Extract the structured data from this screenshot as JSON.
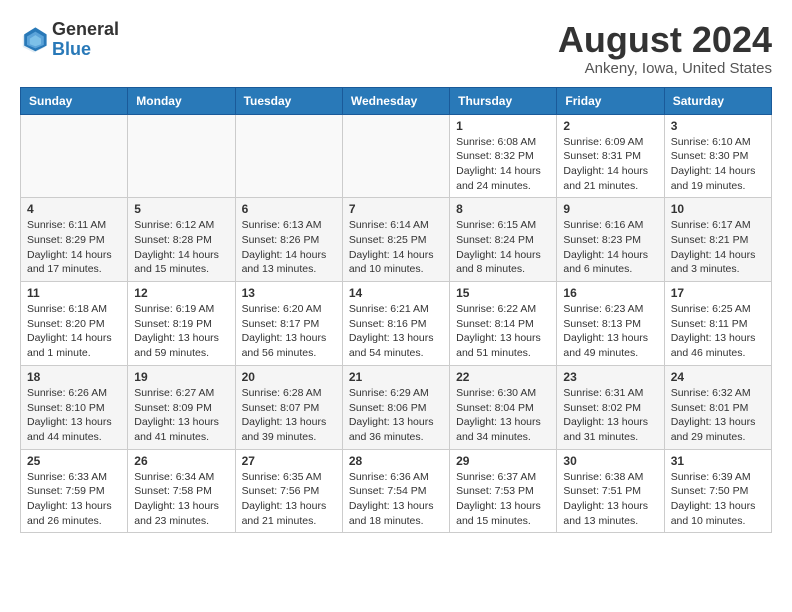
{
  "logo": {
    "text_general": "General",
    "text_blue": "Blue"
  },
  "title": {
    "month_year": "August 2024",
    "location": "Ankeny, Iowa, United States"
  },
  "days_of_week": [
    "Sunday",
    "Monday",
    "Tuesday",
    "Wednesday",
    "Thursday",
    "Friday",
    "Saturday"
  ],
  "weeks": [
    {
      "alt": false,
      "days": [
        {
          "num": "",
          "info": ""
        },
        {
          "num": "",
          "info": ""
        },
        {
          "num": "",
          "info": ""
        },
        {
          "num": "",
          "info": ""
        },
        {
          "num": "1",
          "info": "Sunrise: 6:08 AM\nSunset: 8:32 PM\nDaylight: 14 hours\nand 24 minutes."
        },
        {
          "num": "2",
          "info": "Sunrise: 6:09 AM\nSunset: 8:31 PM\nDaylight: 14 hours\nand 21 minutes."
        },
        {
          "num": "3",
          "info": "Sunrise: 6:10 AM\nSunset: 8:30 PM\nDaylight: 14 hours\nand 19 minutes."
        }
      ]
    },
    {
      "alt": true,
      "days": [
        {
          "num": "4",
          "info": "Sunrise: 6:11 AM\nSunset: 8:29 PM\nDaylight: 14 hours\nand 17 minutes."
        },
        {
          "num": "5",
          "info": "Sunrise: 6:12 AM\nSunset: 8:28 PM\nDaylight: 14 hours\nand 15 minutes."
        },
        {
          "num": "6",
          "info": "Sunrise: 6:13 AM\nSunset: 8:26 PM\nDaylight: 14 hours\nand 13 minutes."
        },
        {
          "num": "7",
          "info": "Sunrise: 6:14 AM\nSunset: 8:25 PM\nDaylight: 14 hours\nand 10 minutes."
        },
        {
          "num": "8",
          "info": "Sunrise: 6:15 AM\nSunset: 8:24 PM\nDaylight: 14 hours\nand 8 minutes."
        },
        {
          "num": "9",
          "info": "Sunrise: 6:16 AM\nSunset: 8:23 PM\nDaylight: 14 hours\nand 6 minutes."
        },
        {
          "num": "10",
          "info": "Sunrise: 6:17 AM\nSunset: 8:21 PM\nDaylight: 14 hours\nand 3 minutes."
        }
      ]
    },
    {
      "alt": false,
      "days": [
        {
          "num": "11",
          "info": "Sunrise: 6:18 AM\nSunset: 8:20 PM\nDaylight: 14 hours\nand 1 minute."
        },
        {
          "num": "12",
          "info": "Sunrise: 6:19 AM\nSunset: 8:19 PM\nDaylight: 13 hours\nand 59 minutes."
        },
        {
          "num": "13",
          "info": "Sunrise: 6:20 AM\nSunset: 8:17 PM\nDaylight: 13 hours\nand 56 minutes."
        },
        {
          "num": "14",
          "info": "Sunrise: 6:21 AM\nSunset: 8:16 PM\nDaylight: 13 hours\nand 54 minutes."
        },
        {
          "num": "15",
          "info": "Sunrise: 6:22 AM\nSunset: 8:14 PM\nDaylight: 13 hours\nand 51 minutes."
        },
        {
          "num": "16",
          "info": "Sunrise: 6:23 AM\nSunset: 8:13 PM\nDaylight: 13 hours\nand 49 minutes."
        },
        {
          "num": "17",
          "info": "Sunrise: 6:25 AM\nSunset: 8:11 PM\nDaylight: 13 hours\nand 46 minutes."
        }
      ]
    },
    {
      "alt": true,
      "days": [
        {
          "num": "18",
          "info": "Sunrise: 6:26 AM\nSunset: 8:10 PM\nDaylight: 13 hours\nand 44 minutes."
        },
        {
          "num": "19",
          "info": "Sunrise: 6:27 AM\nSunset: 8:09 PM\nDaylight: 13 hours\nand 41 minutes."
        },
        {
          "num": "20",
          "info": "Sunrise: 6:28 AM\nSunset: 8:07 PM\nDaylight: 13 hours\nand 39 minutes."
        },
        {
          "num": "21",
          "info": "Sunrise: 6:29 AM\nSunset: 8:06 PM\nDaylight: 13 hours\nand 36 minutes."
        },
        {
          "num": "22",
          "info": "Sunrise: 6:30 AM\nSunset: 8:04 PM\nDaylight: 13 hours\nand 34 minutes."
        },
        {
          "num": "23",
          "info": "Sunrise: 6:31 AM\nSunset: 8:02 PM\nDaylight: 13 hours\nand 31 minutes."
        },
        {
          "num": "24",
          "info": "Sunrise: 6:32 AM\nSunset: 8:01 PM\nDaylight: 13 hours\nand 29 minutes."
        }
      ]
    },
    {
      "alt": false,
      "days": [
        {
          "num": "25",
          "info": "Sunrise: 6:33 AM\nSunset: 7:59 PM\nDaylight: 13 hours\nand 26 minutes."
        },
        {
          "num": "26",
          "info": "Sunrise: 6:34 AM\nSunset: 7:58 PM\nDaylight: 13 hours\nand 23 minutes."
        },
        {
          "num": "27",
          "info": "Sunrise: 6:35 AM\nSunset: 7:56 PM\nDaylight: 13 hours\nand 21 minutes."
        },
        {
          "num": "28",
          "info": "Sunrise: 6:36 AM\nSunset: 7:54 PM\nDaylight: 13 hours\nand 18 minutes."
        },
        {
          "num": "29",
          "info": "Sunrise: 6:37 AM\nSunset: 7:53 PM\nDaylight: 13 hours\nand 15 minutes."
        },
        {
          "num": "30",
          "info": "Sunrise: 6:38 AM\nSunset: 7:51 PM\nDaylight: 13 hours\nand 13 minutes."
        },
        {
          "num": "31",
          "info": "Sunrise: 6:39 AM\nSunset: 7:50 PM\nDaylight: 13 hours\nand 10 minutes."
        }
      ]
    }
  ]
}
